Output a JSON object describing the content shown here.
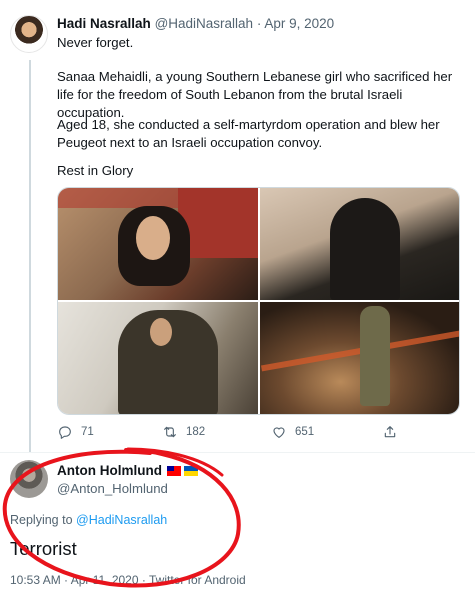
{
  "tweet": {
    "name": "Hadi Nasrallah",
    "handle": "@HadiNasrallah",
    "separator": "·",
    "date": "Apr 9, 2020",
    "paragraphs": [
      "Never forget.",
      "Sanaa Mehaidli, a young Southern Lebanese girl who sacrificed her life for the freedom of South Lebanon from the brutal Israeli occupation.",
      "Aged 18, she conducted a self-martyrdom operation and blew her Peugeot next to an Israeli occupation convoy.",
      "Rest in Glory"
    ],
    "stats": {
      "replies": "71",
      "retweets": "182",
      "likes": "651"
    }
  },
  "reply": {
    "name": "Anton Holmlund",
    "handle": "@Anton_Holmlund",
    "replying_prefix": "Replying to",
    "replying_to": "@HadiNasrallah",
    "text": "Terrorist",
    "timestamp": "10:53 AM · Apr 11, 2020 · Twitter for Android"
  },
  "icons": [
    "reply-icon",
    "retweet-icon",
    "like-icon",
    "share-icon"
  ],
  "colors": {
    "annotation": "#e8141c",
    "link": "#1d9bf0",
    "muted": "#536471"
  }
}
